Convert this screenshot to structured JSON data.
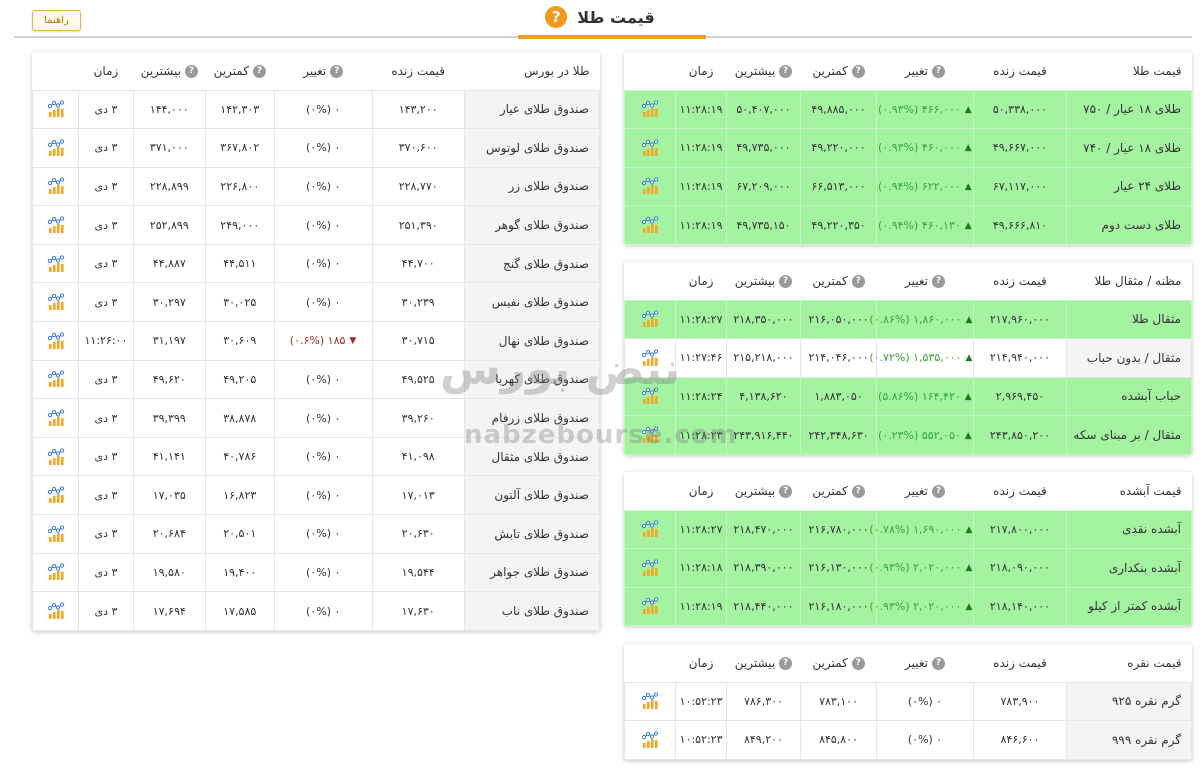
{
  "header": {
    "title": "قیمت طلا",
    "help_icon": "question-circle-icon",
    "guide_button": "راهنما"
  },
  "colors": {
    "accent": "#f0a020",
    "row_up_bg": "#a3f3a0",
    "change_up": "#3aa53a",
    "change_down": "#a02b2b"
  },
  "watermark": {
    "text_fa": "نبض بورس",
    "text_en": "nabzebourse.com"
  },
  "gold_price": {
    "headers": [
      "قیمت طلا",
      "قیمت زنده",
      "تغییر",
      "کمترین",
      "بیشترین",
      "زمان"
    ],
    "rows": [
      {
        "name": "طلای ۱۸ عیار / ۷۵۰",
        "live": "۵۰,۳۳۸,۰۰۰",
        "change": "۴۶۶,۰۰۰ (۰.۹۳%)",
        "dir": "up",
        "low": "۴۹,۸۸۵,۰۰۰",
        "high": "۵۰,۴۰۷,۰۰۰",
        "time": "۱۱:۲۸:۱۹",
        "green": true
      },
      {
        "name": "طلای ۱۸ عیار / ۷۴۰",
        "live": "۴۹,۶۶۷,۰۰۰",
        "change": "۴۶۰,۰۰۰ (۰.۹۳%)",
        "dir": "up",
        "low": "۴۹,۲۲۰,۰۰۰",
        "high": "۴۹,۷۳۵,۰۰۰",
        "time": "۱۱:۲۸:۱۹",
        "green": true
      },
      {
        "name": "طلای ۲۴ عیار",
        "live": "۶۷,۱۱۷,۰۰۰",
        "change": "۶۲۲,۰۰۰ (۰.۹۴%)",
        "dir": "up",
        "low": "۶۶,۵۱۳,۰۰۰",
        "high": "۶۷,۲۰۹,۰۰۰",
        "time": "۱۱:۲۸:۱۹",
        "green": true
      },
      {
        "name": "طلای دست دوم",
        "live": "۴۹,۶۶۶,۸۱۰",
        "change": "۴۶۰,۱۳۰ (۰.۹۴%)",
        "dir": "up",
        "low": "۴۹,۲۲۰,۳۵۰",
        "high": "۴۹,۷۳۵,۱۵۰",
        "time": "۱۱:۲۸:۱۹",
        "green": true
      }
    ]
  },
  "mesghal": {
    "headers": [
      "مظنه / مثقال طلا",
      "قیمت زنده",
      "تغییر",
      "کمترین",
      "بیشترین",
      "زمان"
    ],
    "rows": [
      {
        "name": "مثقال طلا",
        "live": "۲۱۷,۹۶۰,۰۰۰",
        "change": "۱,۸۶۰,۰۰۰ (۰.۸۶%)",
        "dir": "up",
        "low": "۲۱۶,۰۵۰,۰۰۰",
        "high": "۲۱۸,۳۵۰,۰۰۰",
        "time": "۱۱:۲۸:۲۷",
        "green": true
      },
      {
        "name": "مثقال / بدون حباب",
        "live": "۲۱۴,۹۴۰,۰۰۰",
        "change": "۱,۵۳۵,۰۰۰ (۰.۷۲%)",
        "dir": "up",
        "low": "۲۱۴,۰۴۶,۰۰۰",
        "high": "۲۱۵,۲۱۸,۰۰۰",
        "time": "۱۱:۲۷:۴۶",
        "green": false
      },
      {
        "name": "حباب آبشده",
        "live": "۲,۹۶۹,۴۵۰",
        "change": "۱۶۴,۴۲۰ (۵.۸۶%)",
        "dir": "up",
        "low": "۱,۸۸۳,۰۵۰",
        "high": "۴,۱۳۸,۶۲۰",
        "time": "۱۱:۲۸:۲۴",
        "green": true
      },
      {
        "name": "مثقال / بر مبنای سکه",
        "live": "۲۴۳,۸۵۰,۲۰۰",
        "change": "۵۵۲,۰۵۰ (۰.۲۳%)",
        "dir": "up",
        "low": "۲۴۲,۳۴۸,۶۳۰",
        "high": "۲۴۳,۹۱۶,۴۴۰",
        "time": "۱۱:۲۸:۲۳",
        "green": true
      }
    ]
  },
  "abshodeh": {
    "headers": [
      "قیمت آبشده",
      "قیمت زنده",
      "تغییر",
      "کمترین",
      "بیشترین",
      "زمان"
    ],
    "rows": [
      {
        "name": "آبشده نقدی",
        "live": "۲۱۷,۸۰۰,۰۰۰",
        "change": "۱,۶۹۰,۰۰۰ (۰.۷۸%)",
        "dir": "up",
        "low": "۲۱۶,۷۸۰,۰۰۰",
        "high": "۲۱۸,۴۷۰,۰۰۰",
        "time": "۱۱:۲۸:۲۷",
        "green": true
      },
      {
        "name": "آبشده بنکداری",
        "live": "۲۱۸,۰۹۰,۰۰۰",
        "change": "۲,۰۲۰,۰۰۰ (۰.۹۳%)",
        "dir": "up",
        "low": "۲۱۶,۱۳۰,۰۰۰",
        "high": "۲۱۸,۳۹۰,۰۰۰",
        "time": "۱۱:۲۸:۱۸",
        "green": true
      },
      {
        "name": "آبشده کمتر از کیلو",
        "live": "۲۱۸,۱۴۰,۰۰۰",
        "change": "۲,۰۲۰,۰۰۰ (۰.۹۳%)",
        "dir": "up",
        "low": "۲۱۶,۱۸۰,۰۰۰",
        "high": "۲۱۸,۴۴۰,۰۰۰",
        "time": "۱۱:۲۸:۱۹",
        "green": true
      }
    ]
  },
  "silver": {
    "headers": [
      "قیمت نقره",
      "قیمت زنده",
      "تغییر",
      "کمترین",
      "بیشترین",
      "زمان"
    ],
    "rows": [
      {
        "name": "گرم نقره ۹۲۵",
        "live": "۷۸۳,۹۰۰",
        "change": "۰ (۰%)",
        "dir": "none",
        "low": "۷۸۳,۱۰۰",
        "high": "۷۸۶,۳۰۰",
        "time": "۱۰:۵۲:۲۳",
        "green": false
      },
      {
        "name": "گرم نقره ۹۹۹",
        "live": "۸۴۶,۶۰۰",
        "change": "۰ (۰%)",
        "dir": "none",
        "low": "۸۴۵,۸۰۰",
        "high": "۸۴۹,۲۰۰",
        "time": "۱۰:۵۲:۲۳",
        "green": false
      }
    ]
  },
  "bourse": {
    "headers": [
      "طلا در بورس",
      "قیمت زنده",
      "تغییر",
      "کمترین",
      "بیشترین",
      "زمان"
    ],
    "rows": [
      {
        "name": "صندوق طلای عیار",
        "live": "۱۴۳,۲۰۰",
        "change": "۰ (۰%)",
        "dir": "none",
        "low": "۱۴۲,۳۰۳",
        "high": "۱۴۴,۰۰۰",
        "time": "۳ دی"
      },
      {
        "name": "صندوق طلای لوتوس",
        "live": "۳۷۰,۶۰۰",
        "change": "۰ (۰%)",
        "dir": "none",
        "low": "۳۶۷,۸۰۲",
        "high": "۳۷۱,۰۰۰",
        "time": "۳ دی"
      },
      {
        "name": "صندوق طلای زر",
        "live": "۲۲۸,۷۷۰",
        "change": "۰ (۰%)",
        "dir": "none",
        "low": "۲۲۶,۸۰۰",
        "high": "۲۲۸,۸۹۹",
        "time": "۳ دی"
      },
      {
        "name": "صندوق طلای گوهر",
        "live": "۲۵۱,۳۹۰",
        "change": "۰ (۰%)",
        "dir": "none",
        "low": "۲۴۹,۰۰۰",
        "high": "۲۵۲,۸۹۹",
        "time": "۳ دی"
      },
      {
        "name": "صندوق طلای گنج",
        "live": "۴۴,۷۰۰",
        "change": "۰ (۰%)",
        "dir": "none",
        "low": "۴۴,۵۱۱",
        "high": "۴۴,۸۸۷",
        "time": "۳ دی"
      },
      {
        "name": "صندوق طلای نفیس",
        "live": "۳۰,۲۳۹",
        "change": "۰ (۰%)",
        "dir": "none",
        "low": "۳۰,۰۲۵",
        "high": "۳۰,۲۹۷",
        "time": "۳ دی"
      },
      {
        "name": "صندوق طلای نهال",
        "live": "۳۰,۷۱۵",
        "change": "۱۸۵ (۰.۶%)",
        "dir": "down",
        "low": "۳۰,۶۰۹",
        "high": "۳۱,۱۹۷",
        "time": "۱۱:۲۶:۰۰"
      },
      {
        "name": "صندوق طلای کهربا",
        "live": "۴۹,۵۲۵",
        "change": "۰ (۰%)",
        "dir": "none",
        "low": "۴۹,۲۰۵",
        "high": "۴۹,۶۲۰",
        "time": "۳ دی"
      },
      {
        "name": "صندوق طلای زرفام",
        "live": "۳۹,۲۶۰",
        "change": "۰ (۰%)",
        "dir": "none",
        "low": "۳۸,۸۷۸",
        "high": "۳۹,۳۹۹",
        "time": "۳ دی"
      },
      {
        "name": "صندوق طلای مثقال",
        "live": "۴۱,۰۹۸",
        "change": "۰ (۰%)",
        "dir": "none",
        "low": "۴۰,۷۸۶",
        "high": "۴۱,۱۴۱",
        "time": "۳ دی"
      },
      {
        "name": "صندوق طلای آلتون",
        "live": "۱۷,۰۱۳",
        "change": "۰ (۰%)",
        "dir": "none",
        "low": "۱۶,۸۲۳",
        "high": "۱۷,۰۳۵",
        "time": "۳ دی"
      },
      {
        "name": "صندوق طلای تابش",
        "live": "۲۰,۶۳۰",
        "change": "۰ (۰%)",
        "dir": "none",
        "low": "۲۰,۵۰۱",
        "high": "۲۰,۶۸۴",
        "time": "۳ دی"
      },
      {
        "name": "صندوق طلای جواهر",
        "live": "۱۹,۵۴۴",
        "change": "۰ (۰%)",
        "dir": "none",
        "low": "۱۹,۴۰۰",
        "high": "۱۹,۵۸۰",
        "time": "۳ دی"
      },
      {
        "name": "صندوق طلای ناب",
        "live": "۱۷,۶۳۰",
        "change": "۰ (۰%)",
        "dir": "none",
        "low": "۱۷,۵۸۵",
        "high": "۱۷,۶۹۴",
        "time": "۳ دی"
      }
    ]
  }
}
